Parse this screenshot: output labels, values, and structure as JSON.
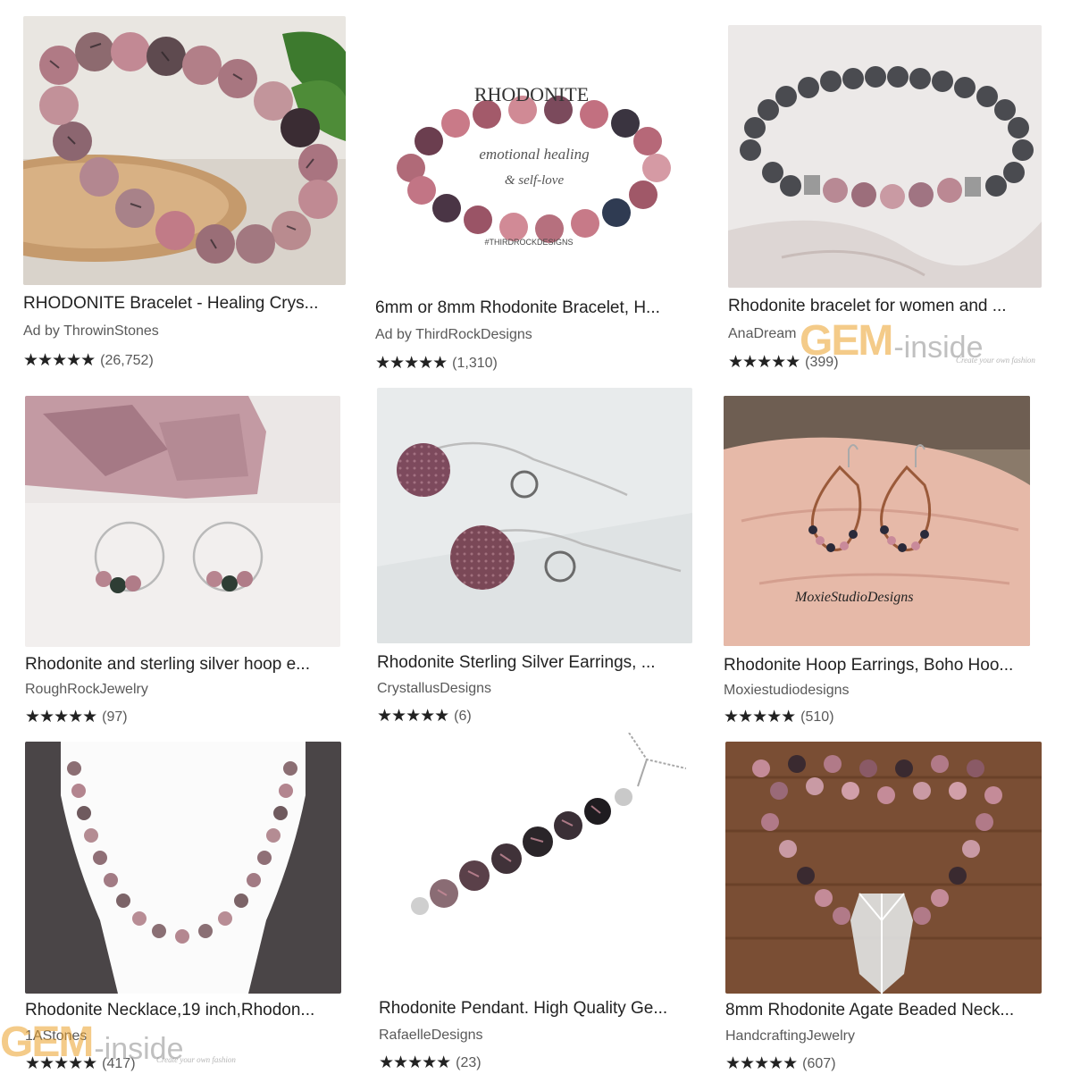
{
  "products": [
    {
      "title": "RHODONITE Bracelet - Healing Crys...",
      "shop": "Ad by ThrowinStones",
      "stars": "★★★★★",
      "reviews": "(26,752)"
    },
    {
      "title": "6mm or 8mm Rhodonite Bracelet, H...",
      "shop": "Ad by ThirdRockDesigns",
      "stars": "★★★★★",
      "reviews": "(1,310)",
      "image_text": {
        "heading": "RHODONITE",
        "line1": "emotional healing",
        "line2": "& self-love",
        "tag": "#THIRDROCKDESIGNS"
      }
    },
    {
      "title": "Rhodonite bracelet for women and ...",
      "shop": "AnaDream",
      "stars": "★★★★★",
      "reviews": "(399)"
    },
    {
      "title": "Rhodonite and sterling silver hoop e...",
      "shop": "RoughRockJewelry",
      "stars": "★★★★★",
      "reviews": "(97)"
    },
    {
      "title": "Rhodonite Sterling Silver Earrings, ...",
      "shop": "CrystallusDesigns",
      "stars": "★★★★★",
      "reviews": "(6)"
    },
    {
      "title": "Rhodonite Hoop Earrings, Boho Hoo...",
      "shop": "Moxiestudiodesigns",
      "stars": "★★★★★",
      "reviews": "(510)",
      "image_text": {
        "signature": "MoxieStudioDesigns"
      }
    },
    {
      "title": "Rhodonite Necklace,19 inch,Rhodon...",
      "shop": "1AStones",
      "stars": "★★★★★",
      "reviews": "(417)"
    },
    {
      "title": "Rhodonite Pendant. High Quality Ge...",
      "shop": "RafaelleDesigns",
      "stars": "★★★★★",
      "reviews": "(23)"
    },
    {
      "title": "8mm Rhodonite Agate Beaded Neck...",
      "shop": "HandcraftingJewelry",
      "stars": "★★★★★",
      "reviews": "(607)"
    }
  ],
  "watermark": {
    "brand": "GEM",
    "suffix": "-inside",
    "tagline": "Create your own fashion"
  },
  "colors": {
    "rhodonite_pink": "#b8757f",
    "dark_vein": "#2a2226",
    "text": "#222222",
    "muted": "#595959",
    "watermark": "#eba028"
  }
}
